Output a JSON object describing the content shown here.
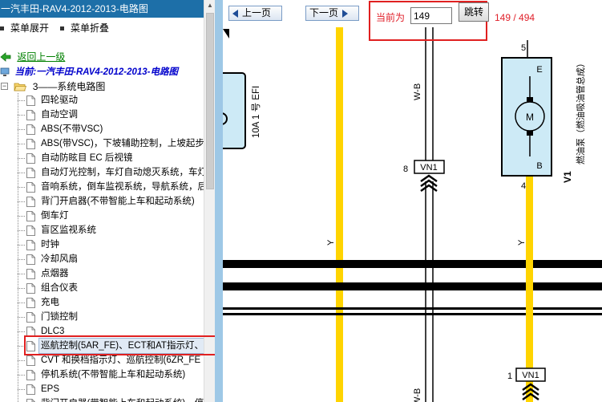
{
  "window": {
    "title": "一汽丰田-RAV4-2012-2013-电路图"
  },
  "menu": {
    "expand_label": "菜单展开",
    "collapse_label": "菜单折叠"
  },
  "tree": {
    "back_label": "返回上一级",
    "current_label": "当前:一汽丰田-RAV4-2012-2013-电路图",
    "folder_label": "3——系统电路图",
    "items": [
      {
        "label": "四轮驱动"
      },
      {
        "label": "自动空调"
      },
      {
        "label": "ABS(不带VSC)"
      },
      {
        "label": "ABS(带VSC)，下坡辅助控制，上坡起步"
      },
      {
        "label": "自动防眩目 EC 后视镜"
      },
      {
        "label": "自动灯光控制，车灯自动熄灭系统，车灯"
      },
      {
        "label": "音响系统，倒车监视系统，导航系统，后"
      },
      {
        "label": "背门开启器(不带智能上车和起动系统)"
      },
      {
        "label": "倒车灯"
      },
      {
        "label": "盲区监视系统"
      },
      {
        "label": "时钟"
      },
      {
        "label": "冷却风扇"
      },
      {
        "label": "点烟器"
      },
      {
        "label": "组合仪表"
      },
      {
        "label": "充电"
      },
      {
        "label": "门锁控制"
      },
      {
        "label": "DLC3"
      },
      {
        "label": "巡航控制(5AR_FE)、ECT和AT指示灯、"
      },
      {
        "label": "CVT 和换档指示灯、巡航控制(6ZR_FE"
      },
      {
        "label": "停机系统(不带智能上车和起动系统)"
      },
      {
        "label": "EPS"
      },
      {
        "label": "背门开启器(带智能上车和起动系统)，停"
      }
    ],
    "selected_index": 17
  },
  "toolbar": {
    "prev_label": "上一页",
    "next_label": "下一页",
    "current_page_label": "当前为",
    "current_page_value": "149",
    "jump_label": "跳转",
    "page_count": "149 / 494"
  },
  "diagram": {
    "fuse_label": "10A 1 号 EFI",
    "wire_wb_top": "W-B",
    "wire_wb_bottom": "W-B",
    "wire_y_left": "Y",
    "wire_y_right": "Y",
    "connector_vn1_top": "VN1",
    "connector_vn1_bottom": "VN1",
    "pin_8": "8",
    "pin_1": "1",
    "pin_5": "5",
    "pin_4": "4",
    "motor_terminal_e": "E",
    "motor_terminal_b": "B",
    "motor_symbol": "M",
    "component_id": "V1",
    "component_name": "燃油泵（燃油吸油管总成）",
    "colors": {
      "yellow_wire": "#ffd400",
      "component_fill": "#cdeaf6",
      "accent_red": "#e02020"
    }
  }
}
